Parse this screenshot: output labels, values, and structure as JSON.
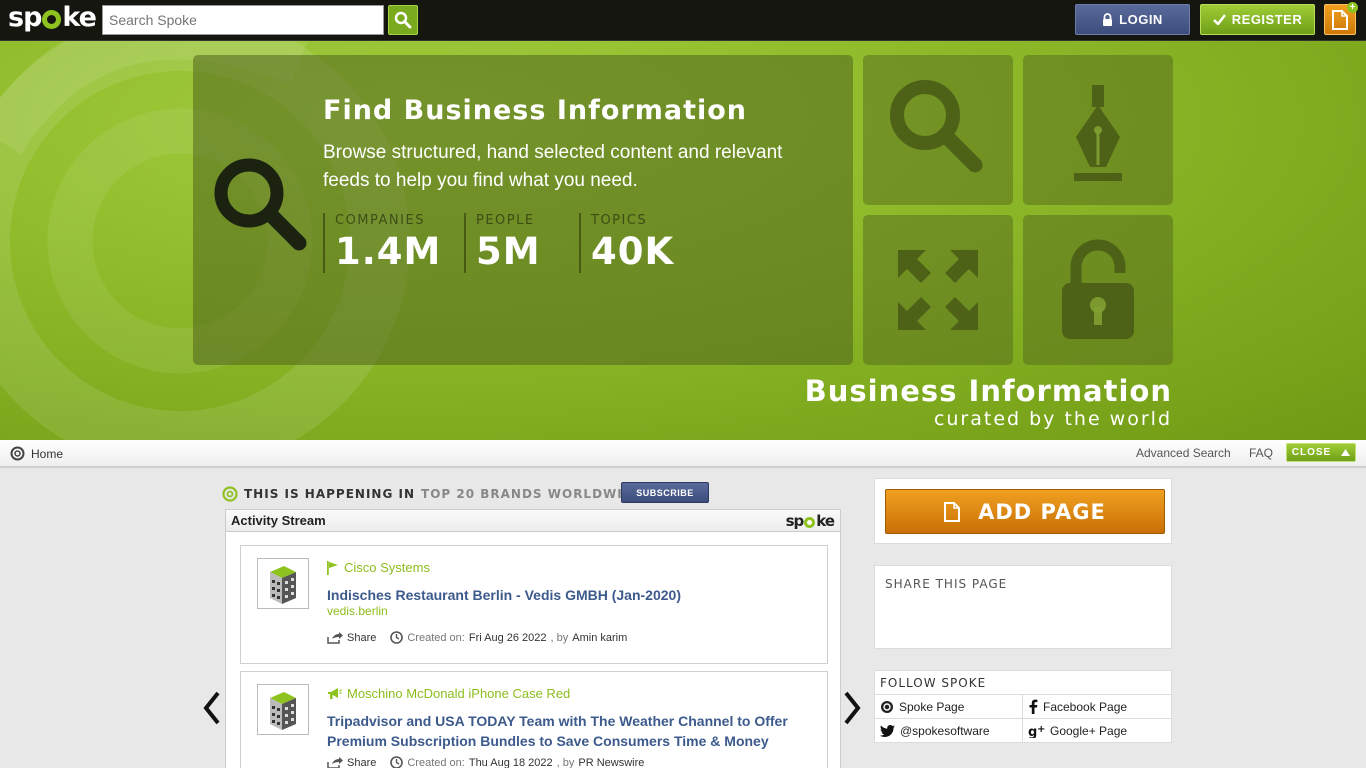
{
  "header": {
    "logo": {
      "pre": "sp",
      "post": "ke"
    },
    "search": {
      "placeholder": "Search Spoke"
    },
    "login_label": "LOGIN",
    "register_label": "REGISTER"
  },
  "hero": {
    "title": "Find Business Information",
    "description": "Browse structured, hand selected content and relevant feeds to help you find what you need.",
    "stats": [
      {
        "label": "COMPANIES",
        "value": "1.4M"
      },
      {
        "label": "PEOPLE",
        "value": "5M"
      },
      {
        "label": "TOPICS",
        "value": "40K"
      }
    ],
    "tagline_main": "Business Information",
    "tagline_sub": "curated by the world"
  },
  "nav": {
    "home": "Home",
    "advanced_search": "Advanced Search",
    "faq": "FAQ",
    "close": "CLOSE"
  },
  "happening": {
    "prefix": "THIS IS HAPPENING IN",
    "scope": "TOP 20 BRANDS WORLDWIDE",
    "subscribe": "SUBSCRIBE"
  },
  "stream": {
    "title": "Activity Stream",
    "logo": {
      "pre": "sp",
      "post": "ke"
    },
    "items": [
      {
        "source": "Cisco Systems",
        "title": "Indisches Restaurant Berlin - Vedis GMBH (Jan-2020)",
        "domain": "vedis.berlin",
        "share": "Share",
        "created_label": "Created on:",
        "date": "Fri Aug 26 2022",
        "by_label": ", by",
        "author": "Amin karim"
      },
      {
        "source": "Moschino McDonald iPhone Case Red",
        "title": "Tripadvisor and USA TODAY Team with The Weather Channel to Offer Premium Subscription Bundles to Save Consumers Time & Money",
        "share": "Share",
        "created_label": "Created on:",
        "date": "Thu Aug 18 2022",
        "by_label": ", by",
        "author": "PR Newswire"
      }
    ]
  },
  "sidebar": {
    "add_page": "ADD PAGE",
    "share_title": "SHARE THIS PAGE",
    "follow_title": "FOLLOW SPOKE",
    "follow_links": [
      "Spoke Page",
      "Facebook Page",
      "@spokesoftware",
      "Google+ Page"
    ]
  },
  "colors": {
    "brand_green": "#8dc21f",
    "login_blue": "#3d4d7c",
    "add_page_orange": "#e08a10",
    "link_blue": "#3c5a8c"
  }
}
